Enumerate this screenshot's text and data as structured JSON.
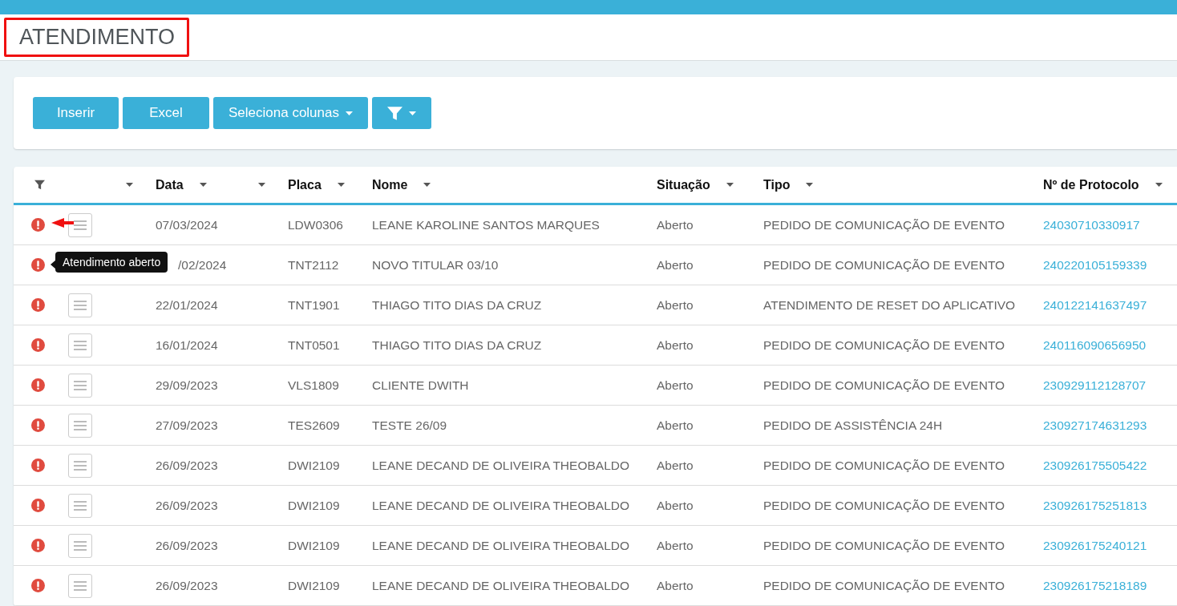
{
  "page": {
    "title": "ATENDIMENTO",
    "title_highlighted": true
  },
  "toolbar": {
    "buttons": [
      {
        "kind": "text",
        "label": "Inserir"
      },
      {
        "kind": "text",
        "label": "Excel"
      },
      {
        "kind": "dropdown",
        "label": "Seleciona colunas"
      },
      {
        "kind": "filter"
      }
    ]
  },
  "table": {
    "columns": [
      {
        "kind": "filter"
      },
      {
        "kind": "blank"
      },
      {
        "kind": "text",
        "label": "Data"
      },
      {
        "kind": "blank"
      },
      {
        "kind": "text",
        "label": "Placa"
      },
      {
        "kind": "text",
        "label": "Nome"
      },
      {
        "kind": "text",
        "label": "Situação"
      },
      {
        "kind": "text",
        "label": "Tipo"
      },
      {
        "kind": "text",
        "label": "Nº de Protocolo"
      }
    ],
    "rows": [
      {
        "alert": true,
        "menu": true,
        "arrow": true,
        "date": "07/03/2024",
        "plate": "LDW0306",
        "name": "LEANE KAROLINE SANTOS MARQUES",
        "situation": "Aberto",
        "type": "PEDIDO DE COMUNICAÇÃO DE EVENTO",
        "protocol": "24030710330917"
      },
      {
        "alert": true,
        "menu": false,
        "tooltip": "Atendimento aberto",
        "date": "/02/2024",
        "plate": "TNT2112",
        "name": "NOVO TITULAR 03/10",
        "situation": "Aberto",
        "type": "PEDIDO DE COMUNICAÇÃO DE EVENTO",
        "protocol": "240220105159339"
      },
      {
        "alert": true,
        "menu": true,
        "date": "22/01/2024",
        "plate": "TNT1901",
        "name": "THIAGO TITO DIAS DA CRUZ",
        "situation": "Aberto",
        "type": "ATENDIMENTO DE RESET DO APLICATIVO",
        "protocol": "240122141637497"
      },
      {
        "alert": true,
        "menu": true,
        "date": "16/01/2024",
        "plate": "TNT0501",
        "name": "THIAGO TITO DIAS DA CRUZ",
        "situation": "Aberto",
        "type": "PEDIDO DE COMUNICAÇÃO DE EVENTO",
        "protocol": "240116090656950"
      },
      {
        "alert": true,
        "menu": true,
        "date": "29/09/2023",
        "plate": "VLS1809",
        "name": "CLIENTE DWITH",
        "situation": "Aberto",
        "type": "PEDIDO DE COMUNICAÇÃO DE EVENTO",
        "protocol": "230929112128707"
      },
      {
        "alert": true,
        "menu": true,
        "date": "27/09/2023",
        "plate": "TES2609",
        "name": "TESTE 26/09",
        "situation": "Aberto",
        "type": "PEDIDO DE ASSISTÊNCIA 24H",
        "protocol": "230927174631293"
      },
      {
        "alert": true,
        "menu": true,
        "date": "26/09/2023",
        "plate": "DWI2109",
        "name": "LEANE DECAND DE OLIVEIRA THEOBALDO",
        "situation": "Aberto",
        "type": "PEDIDO DE COMUNICAÇÃO DE EVENTO",
        "protocol": "230926175505422"
      },
      {
        "alert": true,
        "menu": true,
        "date": "26/09/2023",
        "plate": "DWI2109",
        "name": "LEANE DECAND DE OLIVEIRA THEOBALDO",
        "situation": "Aberto",
        "type": "PEDIDO DE COMUNICAÇÃO DE EVENTO",
        "protocol": "230926175251813"
      },
      {
        "alert": true,
        "menu": true,
        "date": "26/09/2023",
        "plate": "DWI2109",
        "name": "LEANE DECAND DE OLIVEIRA THEOBALDO",
        "situation": "Aberto",
        "type": "PEDIDO DE COMUNICAÇÃO DE EVENTO",
        "protocol": "230926175240121"
      },
      {
        "alert": true,
        "menu": true,
        "date": "26/09/2023",
        "plate": "DWI2109",
        "name": "LEANE DECAND DE OLIVEIRA THEOBALDO",
        "situation": "Aberto",
        "type": "PEDIDO DE COMUNICAÇÃO DE EVENTO",
        "protocol": "230926175218189"
      }
    ]
  }
}
